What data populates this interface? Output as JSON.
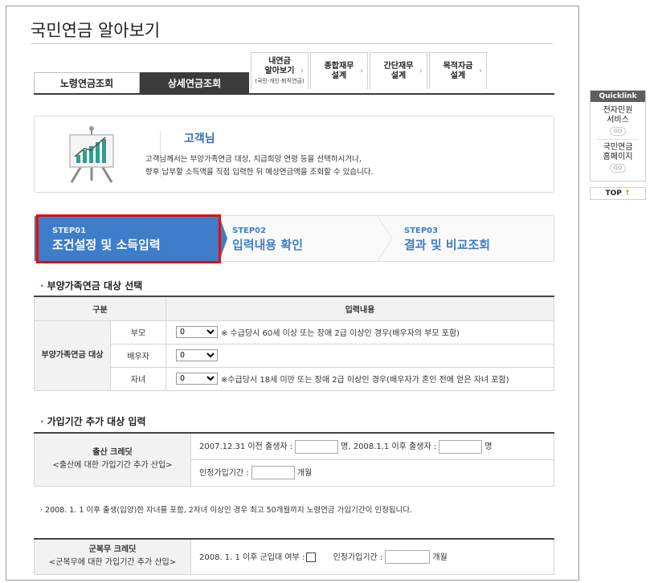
{
  "page": {
    "title": "국민연금 알아보기"
  },
  "tabs": {
    "basic": "노령연금조회",
    "detail": "상세연금조회",
    "small": [
      {
        "label1": "내연금",
        "label2": "알아보기",
        "sub": "(국민·개인·퇴직연금)"
      },
      {
        "label1": "종합재무",
        "label2": "설계",
        "sub": ""
      },
      {
        "label1": "간단재무",
        "label2": "설계",
        "sub": ""
      },
      {
        "label1": "목적자금",
        "label2": "설계",
        "sub": ""
      }
    ],
    "chevron": "›"
  },
  "info": {
    "title": "고객님",
    "line1": "고객님께서는 부양가족연금 대상, 지급희망 연령 등을 선택하시거나,",
    "line2": "향후 납부할 소득액을 직접 입력한 뒤 예상연금액을 조회할 수 있습니다."
  },
  "steps": [
    {
      "num": "STEP01",
      "name": "조건설정 및 소득입력",
      "active": true
    },
    {
      "num": "STEP02",
      "name": "입력내용 확인",
      "active": false
    },
    {
      "num": "STEP03",
      "name": "결과 및 비교조회",
      "active": false
    }
  ],
  "section1": {
    "title": "부양가족연금 대상 선택",
    "head_category": "구분",
    "head_input": "입력내용",
    "category": "부양가족연금 대상",
    "rows": [
      {
        "label": "부모",
        "value": "0",
        "note": "※ 수급당시 60세 이상 또는 장애 2급 이상인 경우(배우자의 부모 포함)"
      },
      {
        "label": "배우자",
        "value": "0",
        "note": ""
      },
      {
        "label": "자녀",
        "value": "0",
        "note": "※수급당시 18세 미만 또는 장애 2급 이상인 경우(배우자가 혼인 전에 얻은 자녀 포함)"
      }
    ]
  },
  "section2": {
    "title": "가입기간 추가 대상 입력",
    "birth": {
      "title": "출산 크레딧",
      "subtitle": "<출산에 대한 가입기간 추가 산입>",
      "before_label": "2007.12.31 이전 출생자 :",
      "before_unit": "명,",
      "after_label": "2008.1.1 이후 출생자 :",
      "after_unit": "명",
      "period_label": "인정가입기간 :",
      "period_unit": "개월"
    },
    "footnote": "2008. 1. 1 이후 출생(입양)한 자녀를 포함, 2자녀 이상인 경우 최고 50개월까지 노령연금 가입기간이 인정됩니다.",
    "military": {
      "title": "군복무 크레딧",
      "subtitle": "<군복무에 대한 가입기간 추가 산입>",
      "enlist_label": "2008. 1. 1 이후 군입대 여부 :",
      "period_label": "인정가입기간 :",
      "period_unit": "개월"
    }
  },
  "quicklink": {
    "head": "Quicklink",
    "items": [
      {
        "line1": "전자민원",
        "line2": "서비스",
        "go": "GO"
      },
      {
        "line1": "국민연금",
        "line2": "홈페이지",
        "go": "GO"
      }
    ],
    "top": "TOP"
  },
  "colors": {
    "accent": "#3d7dc9",
    "highlight": "#e01010",
    "dark_tab": "#3b3b3b"
  }
}
